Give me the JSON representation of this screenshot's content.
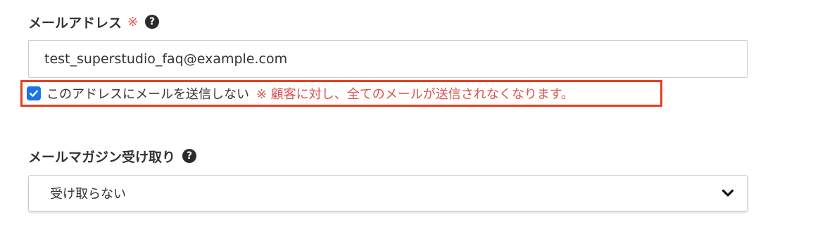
{
  "email_field": {
    "label": "メールアドレス",
    "required_mark": "※",
    "help_icon": "question-circle-icon",
    "value": "test_superstudio_faq@example.com"
  },
  "no_mail_option": {
    "checked": true,
    "label": "このアドレスにメールを送信しない",
    "warning": "※ 顧客に対し、全てのメールが送信されなくなります。",
    "highlight_color": "#e53e22"
  },
  "newsletter_field": {
    "label": "メールマガジン受け取り",
    "help_icon": "question-circle-icon",
    "selected_value": "受け取らない",
    "dropdown_icon": "chevron-down-icon"
  },
  "colors": {
    "required": "#d9534f",
    "warning": "#d9534f",
    "checkbox": "#1a73e8",
    "text": "#333333"
  }
}
